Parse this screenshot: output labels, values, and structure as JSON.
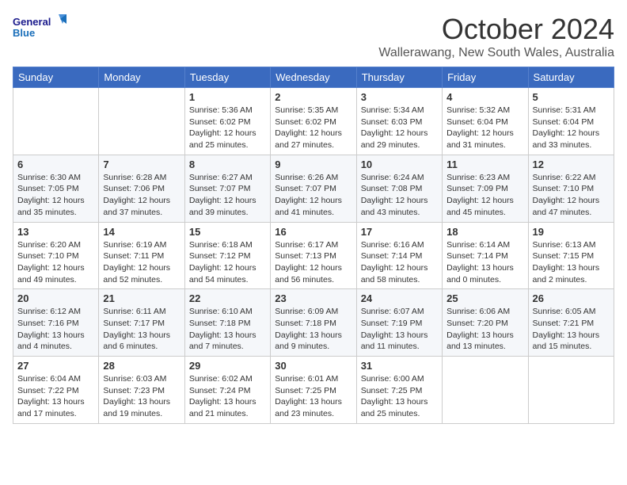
{
  "logo": {
    "line1": "General",
    "line2": "Blue"
  },
  "header": {
    "month": "October 2024",
    "location": "Wallerawang, New South Wales, Australia"
  },
  "days_of_week": [
    "Sunday",
    "Monday",
    "Tuesday",
    "Wednesday",
    "Thursday",
    "Friday",
    "Saturday"
  ],
  "weeks": [
    [
      {
        "day": "",
        "info": ""
      },
      {
        "day": "",
        "info": ""
      },
      {
        "day": "1",
        "info": "Sunrise: 5:36 AM\nSunset: 6:02 PM\nDaylight: 12 hours\nand 25 minutes."
      },
      {
        "day": "2",
        "info": "Sunrise: 5:35 AM\nSunset: 6:02 PM\nDaylight: 12 hours\nand 27 minutes."
      },
      {
        "day": "3",
        "info": "Sunrise: 5:34 AM\nSunset: 6:03 PM\nDaylight: 12 hours\nand 29 minutes."
      },
      {
        "day": "4",
        "info": "Sunrise: 5:32 AM\nSunset: 6:04 PM\nDaylight: 12 hours\nand 31 minutes."
      },
      {
        "day": "5",
        "info": "Sunrise: 5:31 AM\nSunset: 6:04 PM\nDaylight: 12 hours\nand 33 minutes."
      }
    ],
    [
      {
        "day": "6",
        "info": "Sunrise: 6:30 AM\nSunset: 7:05 PM\nDaylight: 12 hours\nand 35 minutes."
      },
      {
        "day": "7",
        "info": "Sunrise: 6:28 AM\nSunset: 7:06 PM\nDaylight: 12 hours\nand 37 minutes."
      },
      {
        "day": "8",
        "info": "Sunrise: 6:27 AM\nSunset: 7:07 PM\nDaylight: 12 hours\nand 39 minutes."
      },
      {
        "day": "9",
        "info": "Sunrise: 6:26 AM\nSunset: 7:07 PM\nDaylight: 12 hours\nand 41 minutes."
      },
      {
        "day": "10",
        "info": "Sunrise: 6:24 AM\nSunset: 7:08 PM\nDaylight: 12 hours\nand 43 minutes."
      },
      {
        "day": "11",
        "info": "Sunrise: 6:23 AM\nSunset: 7:09 PM\nDaylight: 12 hours\nand 45 minutes."
      },
      {
        "day": "12",
        "info": "Sunrise: 6:22 AM\nSunset: 7:10 PM\nDaylight: 12 hours\nand 47 minutes."
      }
    ],
    [
      {
        "day": "13",
        "info": "Sunrise: 6:20 AM\nSunset: 7:10 PM\nDaylight: 12 hours\nand 49 minutes."
      },
      {
        "day": "14",
        "info": "Sunrise: 6:19 AM\nSunset: 7:11 PM\nDaylight: 12 hours\nand 52 minutes."
      },
      {
        "day": "15",
        "info": "Sunrise: 6:18 AM\nSunset: 7:12 PM\nDaylight: 12 hours\nand 54 minutes."
      },
      {
        "day": "16",
        "info": "Sunrise: 6:17 AM\nSunset: 7:13 PM\nDaylight: 12 hours\nand 56 minutes."
      },
      {
        "day": "17",
        "info": "Sunrise: 6:16 AM\nSunset: 7:14 PM\nDaylight: 12 hours\nand 58 minutes."
      },
      {
        "day": "18",
        "info": "Sunrise: 6:14 AM\nSunset: 7:14 PM\nDaylight: 13 hours\nand 0 minutes."
      },
      {
        "day": "19",
        "info": "Sunrise: 6:13 AM\nSunset: 7:15 PM\nDaylight: 13 hours\nand 2 minutes."
      }
    ],
    [
      {
        "day": "20",
        "info": "Sunrise: 6:12 AM\nSunset: 7:16 PM\nDaylight: 13 hours\nand 4 minutes."
      },
      {
        "day": "21",
        "info": "Sunrise: 6:11 AM\nSunset: 7:17 PM\nDaylight: 13 hours\nand 6 minutes."
      },
      {
        "day": "22",
        "info": "Sunrise: 6:10 AM\nSunset: 7:18 PM\nDaylight: 13 hours\nand 7 minutes."
      },
      {
        "day": "23",
        "info": "Sunrise: 6:09 AM\nSunset: 7:18 PM\nDaylight: 13 hours\nand 9 minutes."
      },
      {
        "day": "24",
        "info": "Sunrise: 6:07 AM\nSunset: 7:19 PM\nDaylight: 13 hours\nand 11 minutes."
      },
      {
        "day": "25",
        "info": "Sunrise: 6:06 AM\nSunset: 7:20 PM\nDaylight: 13 hours\nand 13 minutes."
      },
      {
        "day": "26",
        "info": "Sunrise: 6:05 AM\nSunset: 7:21 PM\nDaylight: 13 hours\nand 15 minutes."
      }
    ],
    [
      {
        "day": "27",
        "info": "Sunrise: 6:04 AM\nSunset: 7:22 PM\nDaylight: 13 hours\nand 17 minutes."
      },
      {
        "day": "28",
        "info": "Sunrise: 6:03 AM\nSunset: 7:23 PM\nDaylight: 13 hours\nand 19 minutes."
      },
      {
        "day": "29",
        "info": "Sunrise: 6:02 AM\nSunset: 7:24 PM\nDaylight: 13 hours\nand 21 minutes."
      },
      {
        "day": "30",
        "info": "Sunrise: 6:01 AM\nSunset: 7:25 PM\nDaylight: 13 hours\nand 23 minutes."
      },
      {
        "day": "31",
        "info": "Sunrise: 6:00 AM\nSunset: 7:25 PM\nDaylight: 13 hours\nand 25 minutes."
      },
      {
        "day": "",
        "info": ""
      },
      {
        "day": "",
        "info": ""
      }
    ]
  ]
}
